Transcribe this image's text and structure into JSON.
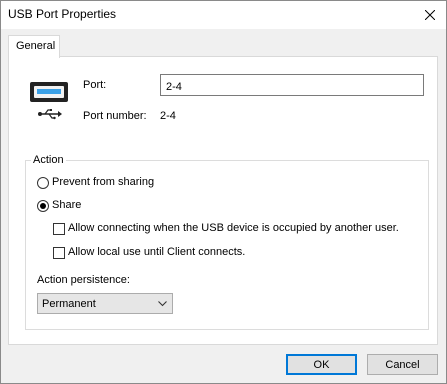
{
  "window": {
    "title": "USB Port Properties"
  },
  "tabs": [
    {
      "label": "General",
      "selected": true
    }
  ],
  "port": {
    "label": "Port:",
    "value": "2-4",
    "number_label": "Port number:",
    "number_value": "2-4"
  },
  "action": {
    "group_label": "Action",
    "prevent_label": "Prevent from sharing",
    "share_label": "Share",
    "selected": "Share",
    "allow_occupied_label": "Allow connecting when the USB device is occupied by another user.",
    "allow_occupied_checked": false,
    "allow_local_label": "Allow local use until Client connects.",
    "allow_local_checked": false,
    "persistence_label": "Action persistence:",
    "persistence_value": "Permanent"
  },
  "buttons": {
    "ok": "OK",
    "cancel": "Cancel"
  },
  "icons": {
    "device": "usb-device-icon",
    "close": "close-icon",
    "dropdown": "chevron-down-icon"
  },
  "colors": {
    "accent": "#0078d7",
    "usb_symbol": "#1a1a1a"
  }
}
